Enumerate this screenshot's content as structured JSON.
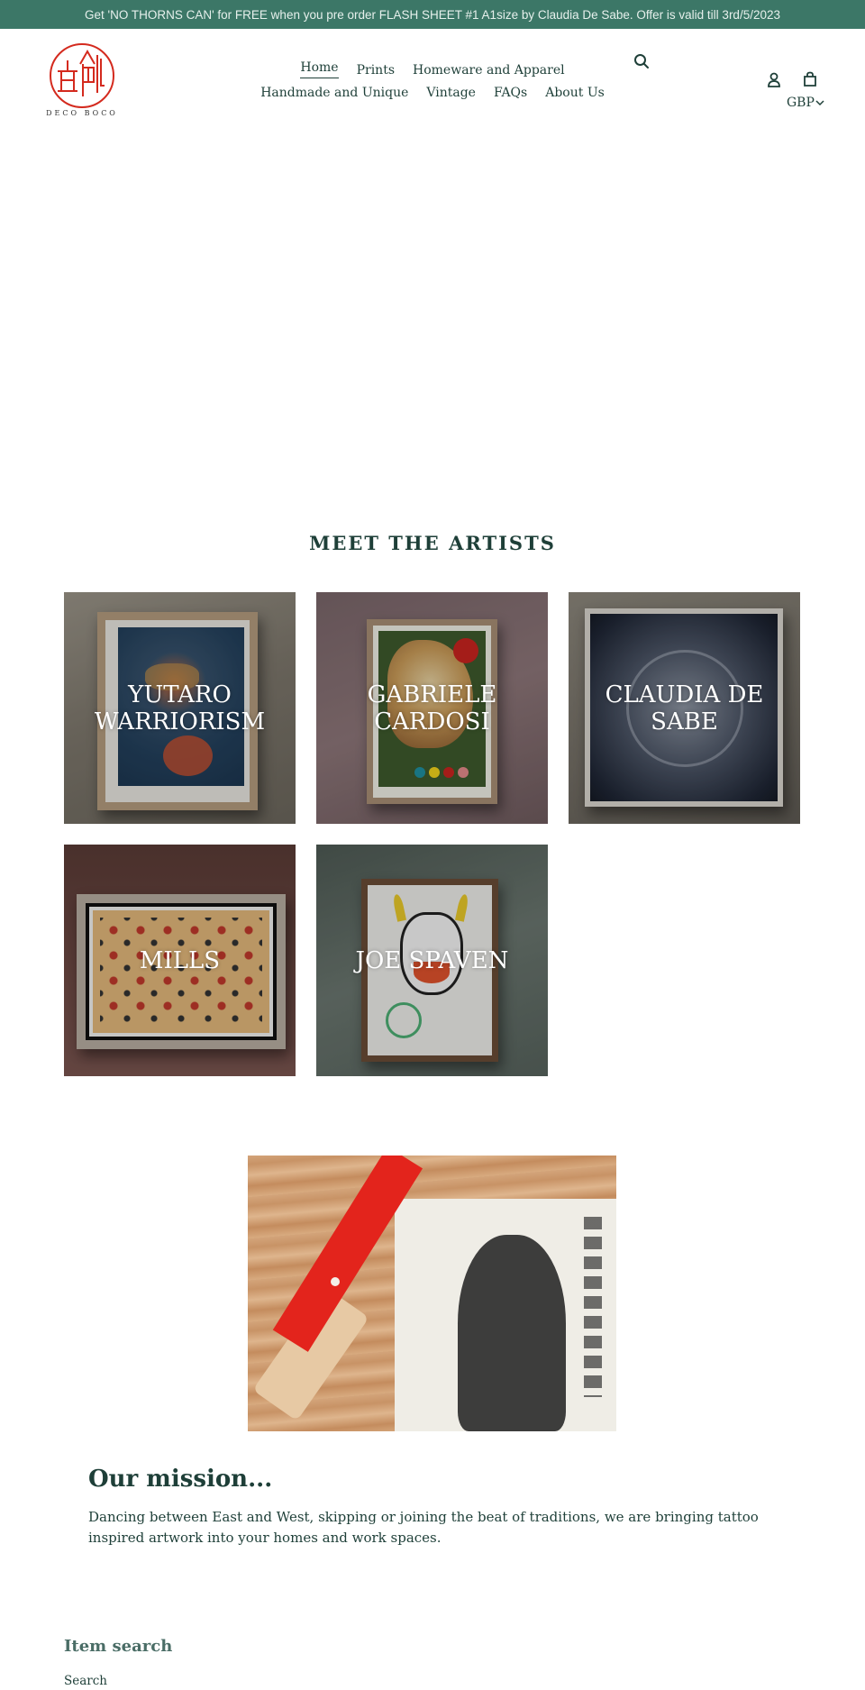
{
  "announcement": {
    "text": "Get 'NO THORNS CAN' for FREE when you pre order FLASH SHEET #1 A1size by Claudia De Sabe. Offer is valid till 3rd/5/2023",
    "background": "#3c7767"
  },
  "header": {
    "logo_text": "DECO BOCO",
    "nav": {
      "row1": [
        {
          "label": "Home",
          "active": true
        },
        {
          "label": "Prints"
        },
        {
          "label": "Homeware and Apparel"
        }
      ],
      "row2": [
        {
          "label": "Handmade and Unique"
        },
        {
          "label": "Vintage"
        },
        {
          "label": "FAQs"
        },
        {
          "label": "About Us"
        }
      ]
    },
    "icons": {
      "search": "search-icon",
      "account": "account-icon",
      "cart": "cart-icon"
    },
    "currency": "GBP"
  },
  "artists": {
    "title": "MEET THE ARTISTS",
    "items": [
      {
        "name": "YUTARO WARRIORISM"
      },
      {
        "name": "GABRIELE CARDOSI"
      },
      {
        "name": "CLAUDIA DE SABE"
      },
      {
        "name": "MILLS"
      },
      {
        "name": "JOE SPAVEN"
      }
    ]
  },
  "mission": {
    "title": "Our mission...",
    "text": "Dancing between East and West, skipping or joining the beat of traditions, we are bringing tattoo inspired artwork into your homes and work spaces."
  },
  "footer": {
    "title": "Item search",
    "link": "Search"
  },
  "colors": {
    "primary_text": "#1e3f38",
    "accent_red": "#d42a1e"
  }
}
